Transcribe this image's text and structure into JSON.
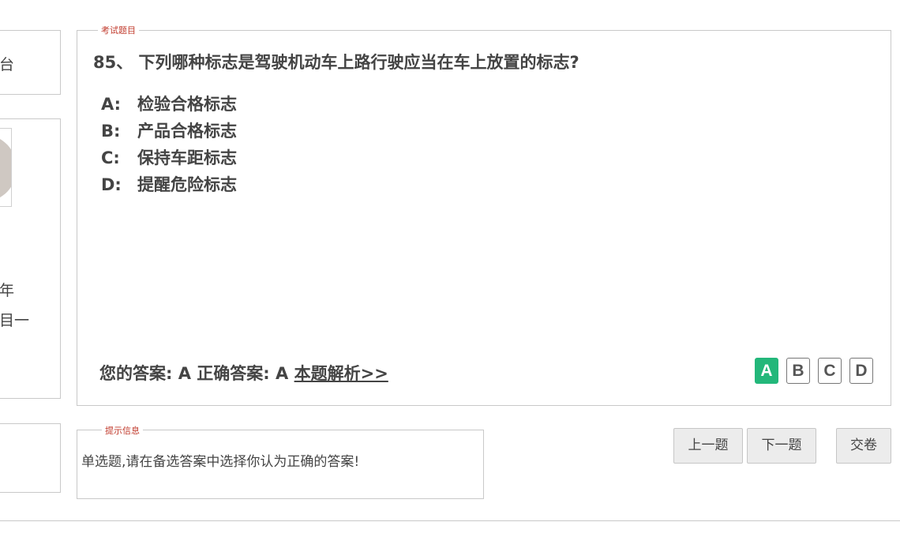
{
  "left_panel": {
    "top_fragment": "台",
    "mid_fragment_1": "年",
    "mid_fragment_2": "目一"
  },
  "question_panel": {
    "legend": "考试题目",
    "question": "85、 下列哪种标志是驾驶机动车上路行驶应当在车上放置的标志?",
    "options": [
      {
        "letter": "A:",
        "text": "检验合格标志"
      },
      {
        "letter": "B:",
        "text": "产品合格标志"
      },
      {
        "letter": "C:",
        "text": "保持车距标志"
      },
      {
        "letter": "D:",
        "text": "提醒危险标志"
      }
    ],
    "your_answer_label": "您的答案:",
    "your_answer": "A",
    "correct_answer_label": "正确答案:",
    "correct_answer": "A",
    "analysis_link": "本题解析>>",
    "answer_buttons": [
      {
        "label": "A",
        "selected": true
      },
      {
        "label": "B",
        "selected": false
      },
      {
        "label": "C",
        "selected": false
      },
      {
        "label": "D",
        "selected": false
      }
    ]
  },
  "hint_panel": {
    "legend": "提示信息",
    "text": "单选题,请在备选答案中选择你认为正确的答案!"
  },
  "navigation": {
    "prev_label": "上一题",
    "next_label": "下一题",
    "submit_label": "交卷"
  },
  "colors": {
    "selected_answer": "#23b77a",
    "legend_text": "#c0392b"
  }
}
